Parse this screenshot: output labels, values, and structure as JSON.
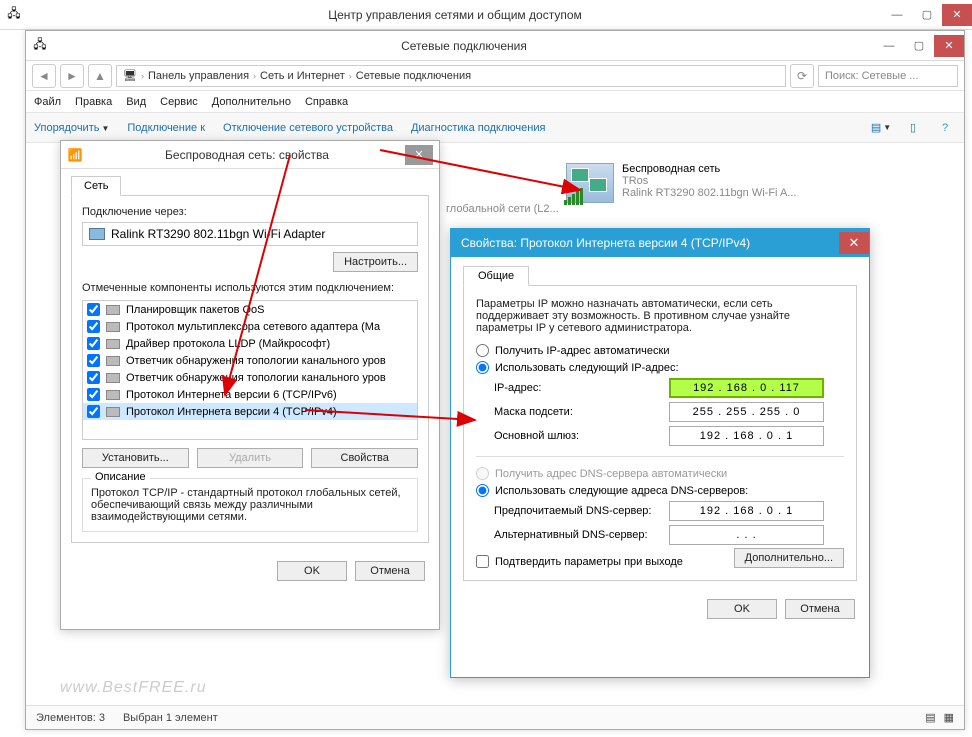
{
  "outer_window": {
    "title": "Центр управления сетями и общим доступом"
  },
  "inner_window": {
    "title": "Сетевые подключения",
    "breadcrumb": [
      "Панель управления",
      "Сеть и Интернет",
      "Сетевые подключения"
    ],
    "search_placeholder": "Поиск: Сетевые ...",
    "menu": {
      "file": "Файл",
      "edit": "Правка",
      "view": "Вид",
      "service": "Сервис",
      "advanced": "Дополнительно",
      "help": "Справка"
    },
    "toolbar": {
      "organize": "Упорядочить",
      "connect": "Подключение к",
      "disable": "Отключение сетевого устройства",
      "diagnose": "Диагностика подключения"
    },
    "ghost_text": "глобальной сети (L2...",
    "netcard": {
      "name": "Беспроводная сеть",
      "sub1": "TRos",
      "sub2": "Ralink RT3290 802.11bgn Wi-Fi A..."
    },
    "statusbar": {
      "elements": "Элементов: 3",
      "selected": "Выбран 1 элемент"
    }
  },
  "dialog1": {
    "title": "Беспроводная сеть: свойства",
    "tab": "Сеть",
    "connect_via": "Подключение через:",
    "adapter": "Ralink RT3290 802.11bgn Wi-Fi Adapter",
    "configure": "Настроить...",
    "components_label": "Отмеченные компоненты используются этим подключением:",
    "components": [
      "Планировщик пакетов QoS",
      "Протокол мультиплексора сетевого адаптера (Ма",
      "Драйвер протокола LLDP (Майкрософт)",
      "Ответчик обнаружения топологии канального уров",
      "Ответчик обнаружения топологии канального уров",
      "Протокол Интернета версии 6 (TCP/IPv6)",
      "Протокол Интернета версии 4 (TCP/IPv4)"
    ],
    "install": "Установить...",
    "remove": "Удалить",
    "properties": "Свойства",
    "description_title": "Описание",
    "description": "Протокол TCP/IP - стандартный протокол глобальных сетей, обеспечивающий связь между различными взаимодействующими сетями.",
    "ok": "OK",
    "cancel": "Отмена"
  },
  "dialog2": {
    "title": "Свойства: Протокол Интернета версии 4 (TCP/IPv4)",
    "tab": "Общие",
    "intro": "Параметры IP можно назначать автоматически, если сеть поддерживает эту возможность. В противном случае узнайте параметры IP у сетевого администратора.",
    "radio_auto_ip": "Получить IP-адрес автоматически",
    "radio_manual_ip": "Использовать следующий IP-адрес:",
    "ip_label": "IP-адрес:",
    "ip_value": "192 . 168 .  0  . 117",
    "mask_label": "Маска подсети:",
    "mask_value": "255 . 255 . 255 .  0",
    "gateway_label": "Основной шлюз:",
    "gateway_value": "192 . 168 .  0  .  1",
    "radio_auto_dns": "Получить адрес DNS-сервера автоматически",
    "radio_manual_dns": "Использовать следующие адреса DNS-серверов:",
    "dns1_label": "Предпочитаемый DNS-сервер:",
    "dns1_value": "192 . 168 .  0  .  1",
    "dns2_label": "Альтернативный DNS-сервер:",
    "dns2_value": " .  .  . ",
    "confirm_exit": "Подтвердить параметры при выходе",
    "advanced": "Дополнительно...",
    "ok": "OK",
    "cancel": "Отмена"
  },
  "watermark": "www.BestFREE.ru"
}
